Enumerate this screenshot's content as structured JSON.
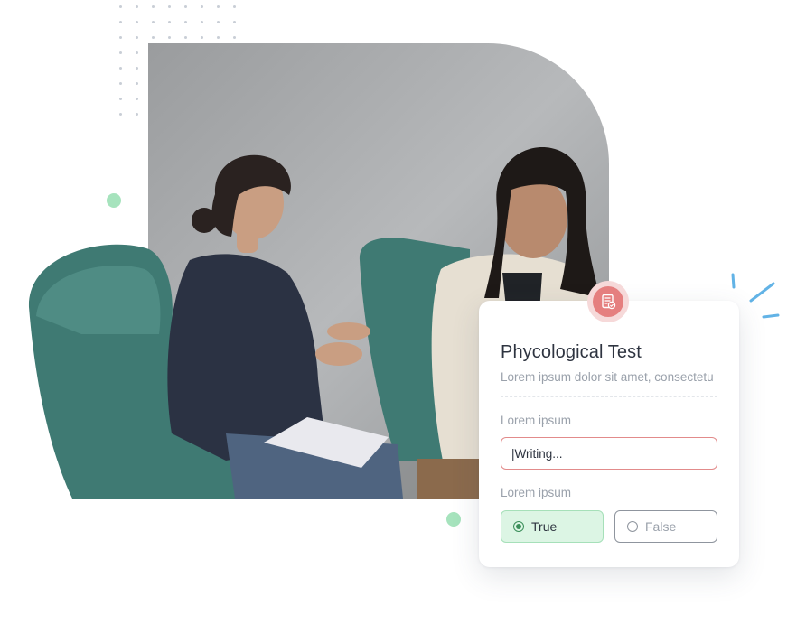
{
  "card": {
    "title": "Phycological Test",
    "subtitle": "Lorem ipsum dolor sit amet, consectetu",
    "badge_icon": "checklist-icon",
    "field1": {
      "label": "Lorem ipsum",
      "value": "|Writing..."
    },
    "field2": {
      "label": "Lorem ipsum",
      "options": [
        {
          "label": "True",
          "selected": true
        },
        {
          "label": "False",
          "selected": false
        }
      ]
    }
  },
  "colors": {
    "accent_red": "#e57f7f",
    "accent_green": "#a6e3bd",
    "sparkle_blue": "#62b3e6"
  }
}
